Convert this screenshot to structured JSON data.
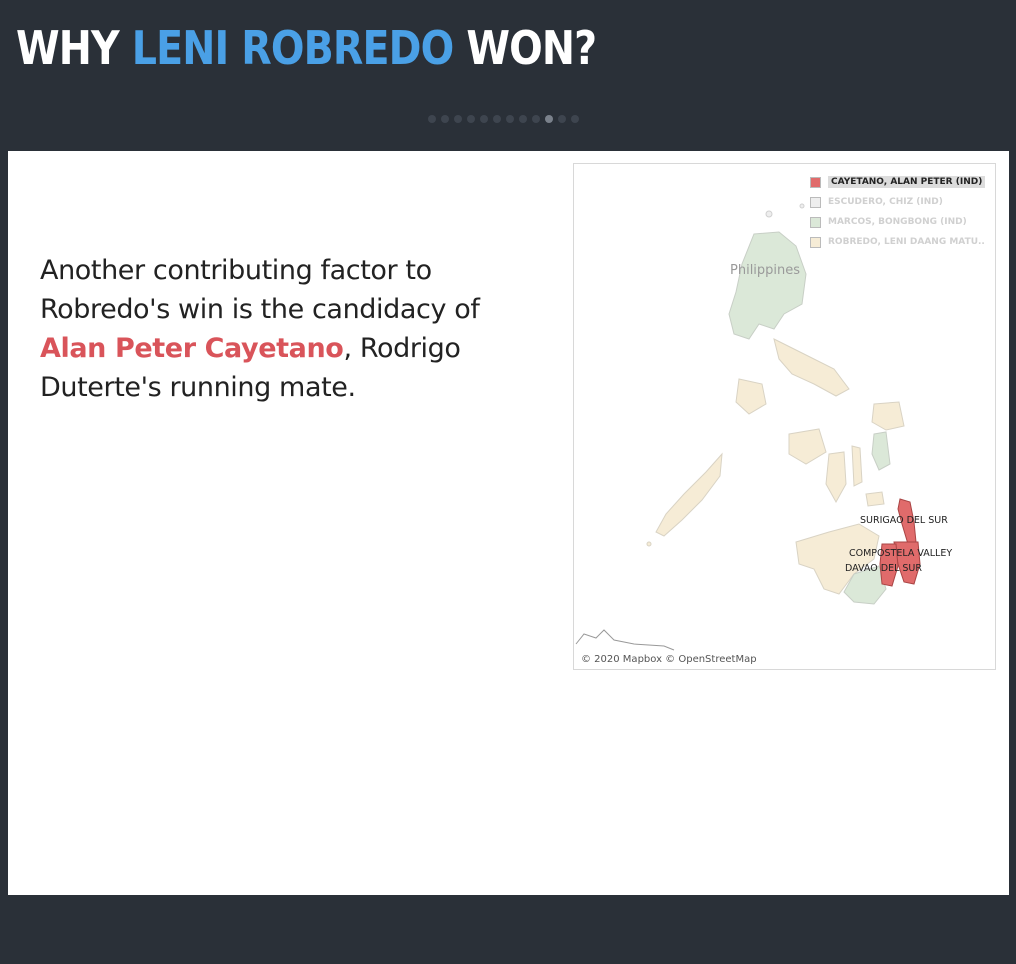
{
  "header": {
    "title_part1": "WHY ",
    "title_accent": "LENI ROBREDO",
    "title_part2": " WON?"
  },
  "pager": {
    "total": 12,
    "active_index": 9
  },
  "story": {
    "line1": "Another contributing factor to Robredo's win is the candidacy of ",
    "highlight": "Alan Peter Cayetano",
    "line2": ", Rodrigo Duterte's running mate."
  },
  "map": {
    "country_label": "Philippines",
    "credit": "© 2020 Mapbox © OpenStreetMap",
    "legend": [
      {
        "label": "CAYETANO, ALAN PETER (IND)",
        "color": "#e06b6b",
        "active": true
      },
      {
        "label": "ESCUDERO, CHIZ (IND)",
        "color": "#eeeeee",
        "active": false
      },
      {
        "label": "MARCOS, BONGBONG (IND)",
        "color": "#dbe8d8",
        "active": false
      },
      {
        "label": "ROBREDO, LENI DAANG MATU..",
        "color": "#f6ecd6",
        "active": false
      }
    ],
    "provinces": [
      {
        "label": "SURIGAO DEL SUR"
      },
      {
        "label": "COMPOSTELA VALLEY"
      },
      {
        "label": "DAVAO DEL SUR"
      }
    ]
  }
}
